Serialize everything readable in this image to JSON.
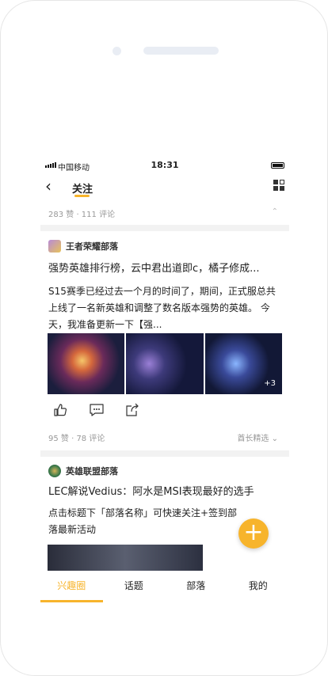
{
  "status": {
    "carrier": "中国移动",
    "time": "18:31"
  },
  "nav": {
    "title": "关注"
  },
  "prev_post": {
    "stats": "283 赞 · 111 评论"
  },
  "post1": {
    "group": "王者荣耀部落",
    "title": "强势英雄排行榜，云中君出道即c，橘子修成...",
    "body": "S15赛季已经过去一个月的时间了，期间，正式服总共上线了一名新英雄和调整了数名版本强势的英雄。 今天，我准备更新一下【强...",
    "more_images": "+3",
    "stats": "95 赞 · 78 评论",
    "tag": "酋长精选"
  },
  "post2": {
    "group": "英雄联盟部落",
    "title": "LEC解说Vedius：阿水是MSI表现最好的选手",
    "body": "点击标题下「部落名称」可快速关注+签到部落最新活动"
  },
  "fab": {
    "label": "+"
  },
  "tabs": [
    "兴趣圈",
    "话题",
    "部落",
    "我的"
  ],
  "colors": {
    "accent": "#f7b42c"
  }
}
